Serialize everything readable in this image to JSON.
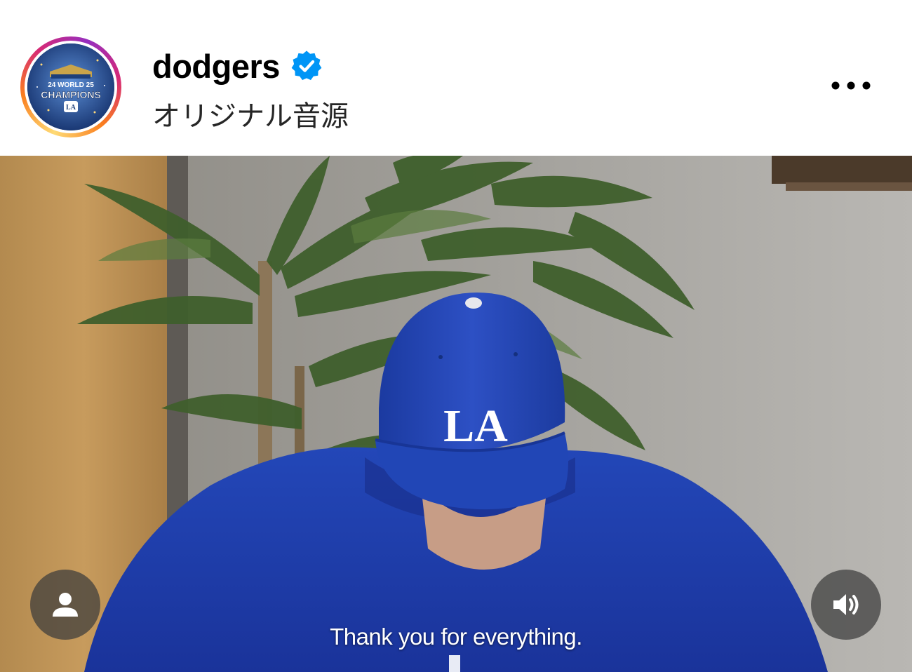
{
  "post": {
    "username": "dodgers",
    "verified": true,
    "audio_label": "オリジナル音源",
    "avatar": {
      "icon": "world-champions-logo",
      "badge_text_top": "24 WORLD 25",
      "badge_text_main": "CHAMPIONS",
      "badge_monogram": "LA"
    },
    "more_icon": "more-horizontal-icon"
  },
  "video": {
    "subtitle": "Thank you for everything.",
    "cap_logo": "LA",
    "tag_icon": "person-icon",
    "audio_icon": "speaker-on-icon"
  },
  "colors": {
    "verified_blue": "#0095f6",
    "dodger_blue": "#1e3fae",
    "text_primary": "#000000"
  }
}
